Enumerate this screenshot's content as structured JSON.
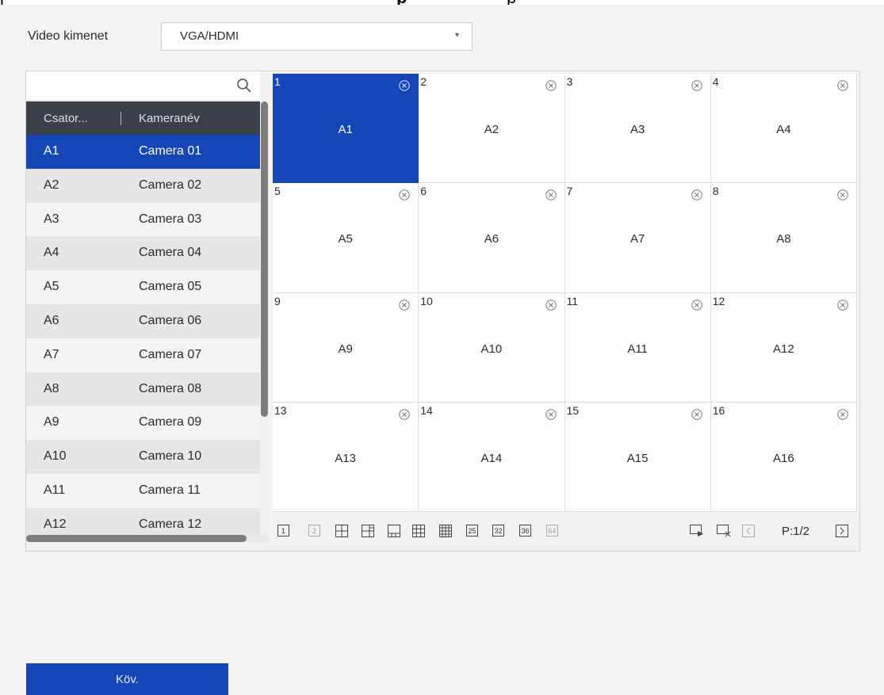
{
  "top_clip": [
    "j",
    "p",
    "p"
  ],
  "video_output": {
    "label": "Video kimenet",
    "value": "VGA/HDMI"
  },
  "search": {
    "placeholder": "",
    "icon": "search-icon"
  },
  "channel_list": {
    "columns": [
      "Csator...",
      "Kameranév"
    ],
    "rows": [
      {
        "channel": "A1",
        "camera": "Camera 01",
        "selected": true
      },
      {
        "channel": "A2",
        "camera": "Camera 02"
      },
      {
        "channel": "A3",
        "camera": "Camera 03"
      },
      {
        "channel": "A4",
        "camera": "Camera 04"
      },
      {
        "channel": "A5",
        "camera": "Camera 05"
      },
      {
        "channel": "A6",
        "camera": "Camera 06"
      },
      {
        "channel": "A7",
        "camera": "Camera 07"
      },
      {
        "channel": "A8",
        "camera": "Camera 08"
      },
      {
        "channel": "A9",
        "camera": "Camera 09"
      },
      {
        "channel": "A10",
        "camera": "Camera 10"
      },
      {
        "channel": "A11",
        "camera": "Camera 11"
      },
      {
        "channel": "A12",
        "camera": "Camera 12"
      }
    ]
  },
  "grid": {
    "cells": [
      {
        "num": "1",
        "label": "A1",
        "selected": true
      },
      {
        "num": "2",
        "label": "A2"
      },
      {
        "num": "3",
        "label": "A3"
      },
      {
        "num": "4",
        "label": "A4"
      },
      {
        "num": "5",
        "label": "A5"
      },
      {
        "num": "6",
        "label": "A6"
      },
      {
        "num": "7",
        "label": "A7"
      },
      {
        "num": "8",
        "label": "A8"
      },
      {
        "num": "9",
        "label": "A9"
      },
      {
        "num": "10",
        "label": "A10"
      },
      {
        "num": "11",
        "label": "A11"
      },
      {
        "num": "12",
        "label": "A12"
      },
      {
        "num": "13",
        "label": "A13"
      },
      {
        "num": "14",
        "label": "A14"
      },
      {
        "num": "15",
        "label": "A15"
      },
      {
        "num": "16",
        "label": "A16"
      }
    ]
  },
  "toolbar": {
    "layout_1": "1",
    "layout_2": "2",
    "layout_25": "25",
    "layout_32": "32",
    "layout_36": "36",
    "layout_64": "64",
    "page": "P:1/2"
  },
  "next_button": {
    "label": "Köv."
  },
  "colors": {
    "accent": "#1546b8",
    "header_bg": "#3b3f4a",
    "background": "#f4f4f4"
  }
}
